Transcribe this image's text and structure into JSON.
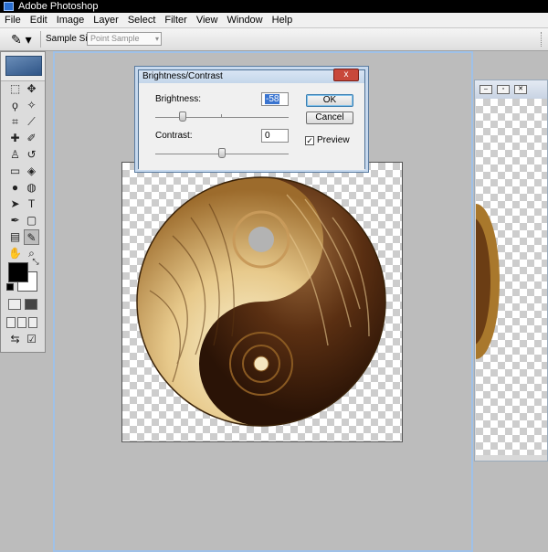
{
  "window": {
    "title": "Adobe Photoshop"
  },
  "menu": [
    "File",
    "Edit",
    "Image",
    "Layer",
    "Select",
    "Filter",
    "View",
    "Window",
    "Help"
  ],
  "options_bar": {
    "sample_size_label": "Sample Size:",
    "sample_size_value": "Point Sample"
  },
  "dialog": {
    "title": "Brightness/Contrast",
    "close_label": "x",
    "brightness_label": "Brightness:",
    "brightness_value": "-58",
    "contrast_label": "Contrast:",
    "contrast_value": "0",
    "ok_label": "OK",
    "cancel_label": "Cancel",
    "preview_label": "Preview",
    "preview_checked": true
  },
  "toolbox": {
    "tools": [
      "marquee-icon",
      "move-icon",
      "lasso-icon",
      "magic-wand-icon",
      "crop-icon",
      "slice-icon",
      "healing-brush-icon",
      "brush-icon",
      "clone-stamp-icon",
      "history-brush-icon",
      "eraser-icon",
      "paint-bucket-icon",
      "blur-icon",
      "dodge-icon",
      "path-selection-icon",
      "type-icon",
      "pen-icon",
      "shape-icon",
      "notes-icon",
      "eyedropper-icon",
      "hand-icon",
      "zoom-icon"
    ],
    "foreground_color": "#000000",
    "background_color": "#ffffff"
  },
  "colors": {
    "accent": "#3a74d0",
    "close_button": "#c8483b"
  }
}
